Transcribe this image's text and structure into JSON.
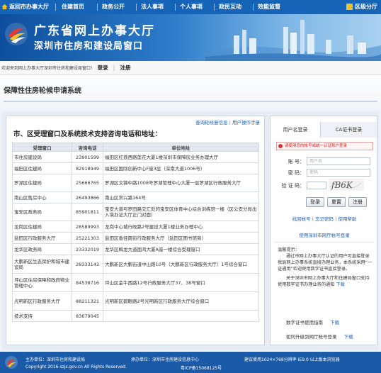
{
  "topnav": {
    "items": [
      "返回市办事大厅",
      "住建首页",
      "政务公开",
      "法人事项",
      "个人事项",
      "政民互动",
      "效能监督"
    ],
    "region": "区级分厅"
  },
  "banner": {
    "title": "广东省网上办事大厅",
    "subtitle": "深圳市住房和建设局窗口"
  },
  "welcome": {
    "message": "欢迎来到网上办事大厅深圳市住房和建设局窗口!",
    "login": "登录",
    "register": "注册"
  },
  "page": {
    "title": "保障性住房轮候申请系统"
  },
  "left": {
    "links": [
      "查询轮候册信息",
      "用户操作手册"
    ],
    "heading": "市、区受理窗口及系统技术支持咨询电话和地址：",
    "columns": [
      "受理窗口",
      "咨询电话",
      "单位地址"
    ],
    "rows": [
      [
        "市住房建设局",
        "23901599",
        "福田区红荔西路莲花大厦1楼深圳市保障房业务办理大厅"
      ],
      [
        "福田区住建局",
        "82918949",
        "福田区国际创新中心F座3层（深南大道1006号）"
      ],
      [
        "罗湖区住建局",
        "25666765",
        "罗湖区文锦中路1008号罗湖管理中心大厦一层罗湖区行政服务大厅"
      ],
      [
        "南山区售房中心",
        "26493866",
        "南山区常兴路164号"
      ],
      [
        "宝安区政务局",
        "85901811",
        "宝安大道与罗田路交汇处的宝安区体育中心综合训练馆一楼（区公安分局出入境办证大厅正门对面）"
      ],
      [
        "龙岗区住建局",
        "28589993",
        "龙岗中心城行政路2号建设大厦1楼业务办理中心"
      ],
      [
        "盐田区行政服务大厅",
        "25221303",
        "盐田区香径南街行政服务大厅（盐田区图书馆旁）"
      ],
      [
        "龙华区政务局",
        "23332019",
        "龙华区梅龙大道国鸿大厦A座一楼综合受理窗口"
      ],
      [
        "大鹏新区生态保护和城市建设局",
        "28333143",
        "大鹏新区大鹏街道中山路10号（大鹏新区行政服务大厅）1号综合窗口"
      ],
      [
        "坪山区住房保障和政府物业管理中心",
        "84538716",
        "坪山区金牛西路12号行政服务大厅37、38号窗口"
      ],
      [
        "光明新区行政服务大厅",
        "88211321",
        "光明新区碧眼路2号光明新区行政服务大厅综合窗口"
      ],
      [
        "技术支持",
        "83679045",
        ""
      ]
    ]
  },
  "login": {
    "tabs": [
      "用户名登录",
      "CA证书登录"
    ],
    "warning": "请使用您的帐号或统一认证账户登录",
    "account_label": "账 号：",
    "account_placeholder": "用户名",
    "password_label": "密 码：",
    "password_placeholder": "密码",
    "captcha_label": "验 证 码：",
    "captcha_text": "fB6K",
    "buttons": [
      "登录",
      "重置",
      "注册"
    ],
    "links": [
      "找回帐号",
      "忘记密码",
      "使用帮助"
    ],
    "register_link": "使用深圳市网厅帐号登录",
    "tips_title": "温馨提示：",
    "tips_p1": "通过市网上办事大厅认证的用户可直接登录我局网上办事系统直接办理业务，本系统采用“一证通用”欢迎使用数字证书直接登录。",
    "tips_p2_a": "关于深圳市网上办事大厅和住建局窗口支持使用数字证书办理业务的通知",
    "tips_p2_link": "下载",
    "cert_guide": "数字证书使用指南",
    "cert_guide_link": "下载",
    "upgrade": "如何升级到网厅帐号登录",
    "upgrade_link": "下载"
  },
  "footer": {
    "host": "主办单位：深圳市住房和建设局",
    "undertake": "承办单位：深圳市住房建设信息中心",
    "resolution": "建议使用1024×768分辨率 IE9.0 以上版本浏览器",
    "copyright": "Copyright 2016 szjs.gov.cn All Rights Reserved.",
    "icp": "粤ICP备15068125号"
  },
  "colors": {
    "nav": "#1664b7",
    "footer": "#1a5aa6",
    "link": "#1d5fb5"
  }
}
